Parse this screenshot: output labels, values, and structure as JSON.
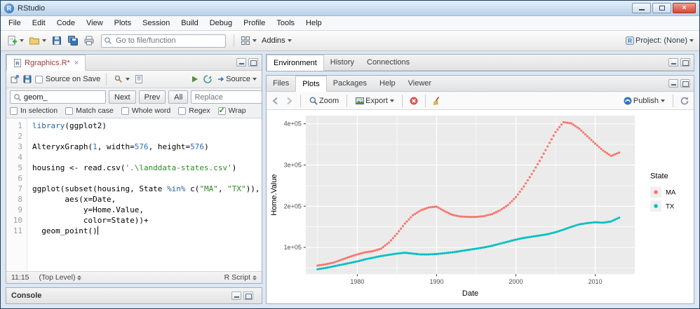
{
  "window": {
    "title": "RStudio"
  },
  "menubar": {
    "items": [
      "File",
      "Edit",
      "Code",
      "View",
      "Plots",
      "Session",
      "Build",
      "Debug",
      "Profile",
      "Tools",
      "Help"
    ]
  },
  "main_toolbar": {
    "goto_placeholder": "Go to file/function",
    "addins_label": "Addins",
    "project_label": "Project: (None)"
  },
  "source_pane": {
    "tab_title": "Rgraphics.R*",
    "source_on_save_label": "Source on Save",
    "source_button_label": "Source",
    "find": {
      "query": "geom_",
      "next_label": "Next",
      "prev_label": "Prev",
      "all_label": "All",
      "replace_placeholder": "Replace",
      "options": [
        {
          "label": "In selection",
          "checked": false
        },
        {
          "label": "Match case",
          "checked": false
        },
        {
          "label": "Whole word",
          "checked": false
        },
        {
          "label": "Regex",
          "checked": false
        },
        {
          "label": "Wrap",
          "checked": true
        }
      ]
    },
    "code_lines": [
      [
        {
          "t": "library",
          "c": "kw"
        },
        {
          "t": "(ggplot2)",
          "c": "pl"
        }
      ],
      [],
      [
        {
          "t": "AlteryxGraph(",
          "c": "pl"
        },
        {
          "t": "1",
          "c": "num"
        },
        {
          "t": ", width=",
          "c": "pl"
        },
        {
          "t": "576",
          "c": "num"
        },
        {
          "t": ", height=",
          "c": "pl"
        },
        {
          "t": "576",
          "c": "num"
        },
        {
          "t": ")",
          "c": "pl"
        }
      ],
      [],
      [
        {
          "t": "housing <- read.csv(",
          "c": "pl"
        },
        {
          "t": "'.\\landdata-states.csv'",
          "c": "str"
        },
        {
          "t": ")",
          "c": "pl"
        }
      ],
      [],
      [
        {
          "t": "ggplot(subset(housing, State ",
          "c": "pl"
        },
        {
          "t": "%in%",
          "c": "kw"
        },
        {
          "t": " c(",
          "c": "pl"
        },
        {
          "t": "\"MA\"",
          "c": "str"
        },
        {
          "t": ", ",
          "c": "pl"
        },
        {
          "t": "\"TX\"",
          "c": "str"
        },
        {
          "t": ")),",
          "c": "pl"
        }
      ],
      [
        {
          "t": "       aes(x=Date,",
          "c": "pl"
        }
      ],
      [
        {
          "t": "           y=Home.Value,",
          "c": "pl"
        }
      ],
      [
        {
          "t": "           color=State))+",
          "c": "pl"
        }
      ],
      [
        {
          "t": "  geom_point()",
          "c": "pl"
        }
      ]
    ],
    "status": {
      "cursor_position": "11:15",
      "scope": "(Top Level)",
      "file_type": "R Script"
    }
  },
  "console_pane": {
    "title": "Console"
  },
  "environment_pane": {
    "tabs": [
      {
        "label": "Environment",
        "active": true
      },
      {
        "label": "History",
        "active": false
      },
      {
        "label": "Connections",
        "active": false
      }
    ]
  },
  "plots_pane": {
    "tabs": [
      {
        "label": "Files",
        "active": false
      },
      {
        "label": "Plots",
        "active": true
      },
      {
        "label": "Packages",
        "active": false
      },
      {
        "label": "Help",
        "active": false
      },
      {
        "label": "Viewer",
        "active": false
      }
    ],
    "toolbar": {
      "zoom_label": "Zoom",
      "export_label": "Export",
      "publish_label": "Publish"
    }
  },
  "chart_data": {
    "type": "scatter",
    "xlabel": "Date",
    "ylabel": "Home.Value",
    "legend_title": "State",
    "xlim": [
      1973.5,
      2015
    ],
    "ylim": [
      35000,
      420000
    ],
    "x_ticks": [
      1980,
      1990,
      2000,
      2010
    ],
    "x_minor": [
      1975,
      1985,
      1995,
      2005
    ],
    "y_ticks": [
      100000,
      200000,
      300000,
      400000
    ],
    "y_tick_labels": [
      "1e+05",
      "2e+05",
      "3e+05",
      "4e+05"
    ],
    "y_minor": [
      50000,
      150000,
      250000,
      350000
    ],
    "panel_bg": "#EBEBEB",
    "grid_color": "#FFFFFF",
    "legend_position": "right",
    "series": [
      {
        "name": "MA",
        "color": "#F8766D",
        "x": [
          1975,
          1976,
          1977,
          1978,
          1979,
          1980,
          1981,
          1982,
          1983,
          1984,
          1985,
          1986,
          1987,
          1988,
          1989,
          1990,
          1991,
          1992,
          1993,
          1994,
          1995,
          1996,
          1997,
          1998,
          1999,
          2000,
          2001,
          2002,
          2003,
          2004,
          2005,
          2006,
          2007,
          2008,
          2009,
          2010,
          2011,
          2012,
          2013
        ],
        "y": [
          56000,
          59000,
          63000,
          70000,
          77000,
          83000,
          88000,
          91000,
          97000,
          112000,
          133000,
          158000,
          178000,
          190000,
          197000,
          199000,
          188000,
          179000,
          175000,
          174000,
          174000,
          176000,
          181000,
          190000,
          203000,
          222000,
          248000,
          278000,
          310000,
          345000,
          380000,
          404000,
          401000,
          388000,
          370000,
          352000,
          335000,
          322000,
          330000
        ]
      },
      {
        "name": "TX",
        "color": "#00BFC4",
        "x": [
          1975,
          1976,
          1977,
          1978,
          1979,
          1980,
          1981,
          1982,
          1983,
          1984,
          1985,
          1986,
          1987,
          1988,
          1989,
          1990,
          1991,
          1992,
          1993,
          1994,
          1995,
          1996,
          1997,
          1998,
          1999,
          2000,
          2001,
          2002,
          2003,
          2004,
          2005,
          2006,
          2007,
          2008,
          2009,
          2010,
          2011,
          2012,
          2013
        ],
        "y": [
          47000,
          50000,
          54000,
          58000,
          62000,
          66000,
          71000,
          75000,
          79000,
          82000,
          85000,
          87000,
          85000,
          83000,
          83000,
          84000,
          86000,
          88000,
          91000,
          94000,
          97000,
          100000,
          104000,
          109000,
          114000,
          119000,
          123000,
          126000,
          129000,
          132000,
          137000,
          143000,
          150000,
          156000,
          159000,
          161000,
          160000,
          163000,
          172000
        ]
      }
    ]
  }
}
